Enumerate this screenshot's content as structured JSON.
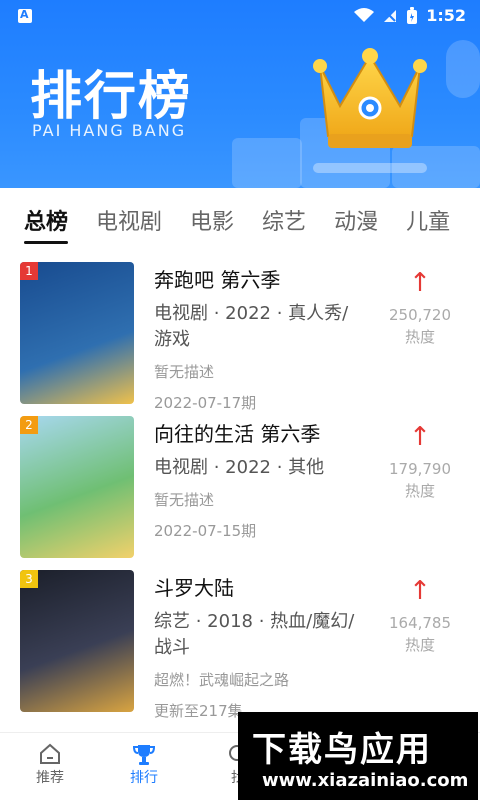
{
  "status": {
    "time": "1:52"
  },
  "header": {
    "title": "排行榜",
    "subtitle": "PAI HANG BANG"
  },
  "tabs": [
    {
      "label": "总榜",
      "active": true
    },
    {
      "label": "电视剧",
      "active": false
    },
    {
      "label": "电影",
      "active": false
    },
    {
      "label": "综艺",
      "active": false
    },
    {
      "label": "动漫",
      "active": false
    },
    {
      "label": "儿童",
      "active": false
    }
  ],
  "items": [
    {
      "rank": "1",
      "title": "奔跑吧 第六季",
      "meta": "电视剧 · 2022 · 真人秀/游戏",
      "desc": "暂无描述",
      "date": "2022-07-17期",
      "heat_value": "250,720",
      "heat_label": "热度",
      "poster_colors": [
        "#184b8f",
        "#2f6fb0",
        "#f0c14b"
      ]
    },
    {
      "rank": "2",
      "title": "向往的生活 第六季",
      "meta": "电视剧 · 2022 · 其他",
      "desc": "暂无描述",
      "date": "2022-07-15期",
      "heat_value": "179,790",
      "heat_label": "热度",
      "poster_colors": [
        "#a8d8f0",
        "#6fbf73",
        "#f2d16b"
      ]
    },
    {
      "rank": "3",
      "title": "斗罗大陆",
      "meta": "综艺 · 2018 · 热血/魔幻/战斗",
      "desc": "超燃！武魂崛起之路",
      "date": "更新至217集",
      "heat_value": "164,785",
      "heat_label": "热度",
      "poster_colors": [
        "#1b1f2a",
        "#3a3f55",
        "#d9a441"
      ]
    }
  ],
  "bottom_nav": [
    {
      "label": "推荐",
      "icon": "home-icon",
      "active": false
    },
    {
      "label": "排行",
      "icon": "trophy-icon",
      "active": true
    },
    {
      "label": "找",
      "icon": "search-icon",
      "active": false
    }
  ],
  "watermark": {
    "main": "下载鸟应用",
    "sub": "www.xiazainiao.com"
  },
  "colors": {
    "brand": "#1e7dff",
    "up_arrow": "#e53935"
  }
}
